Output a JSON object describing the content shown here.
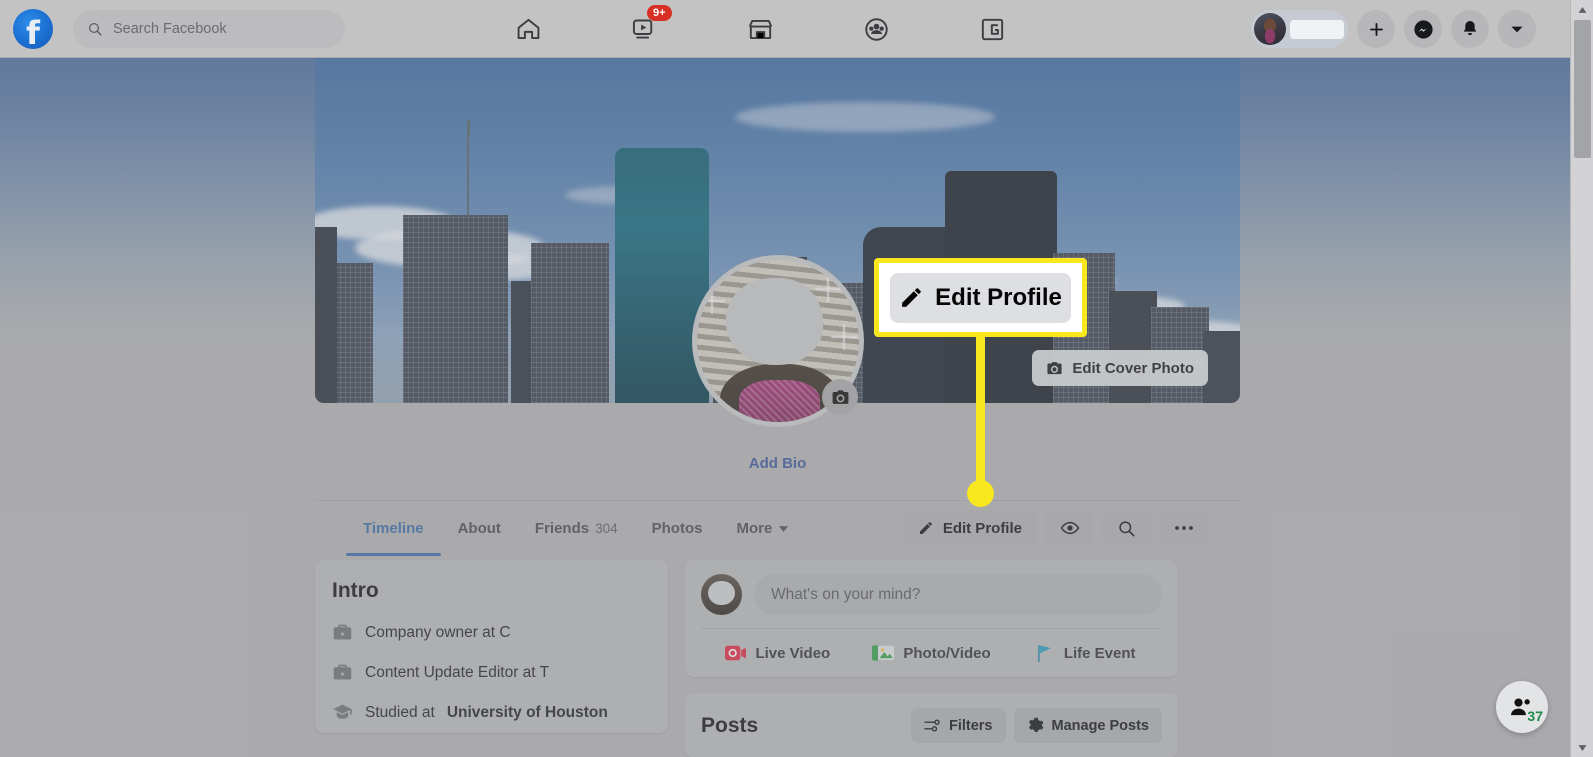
{
  "header": {
    "logo_icon": "facebook-logo",
    "search": {
      "placeholder": "Search Facebook",
      "icon": "search-icon"
    },
    "nav": [
      {
        "name": "home",
        "icon": "home-icon",
        "badge": ""
      },
      {
        "name": "watch",
        "icon": "video-icon",
        "badge": "9+"
      },
      {
        "name": "marketplace",
        "icon": "marketplace-icon",
        "badge": ""
      },
      {
        "name": "groups",
        "icon": "groups-icon",
        "badge": ""
      },
      {
        "name": "gaming",
        "icon": "gaming-icon",
        "badge": ""
      }
    ],
    "account": {
      "name_redacted": "",
      "icon": "avatar"
    },
    "right_buttons": [
      {
        "name": "create",
        "icon": "plus-icon"
      },
      {
        "name": "messenger",
        "icon": "messenger-icon"
      },
      {
        "name": "notifications",
        "icon": "bell-icon"
      },
      {
        "name": "account-menu",
        "icon": "chevron-down-icon"
      }
    ]
  },
  "cover": {
    "edit_cover_label": "Edit Cover Photo",
    "edit_cover_icon": "camera-icon",
    "profile_camera_icon": "camera-icon"
  },
  "callout": {
    "label": "Edit Profile",
    "icon": "pencil-icon",
    "border_color": "#f9e71e",
    "connector_color": "#f9e71e"
  },
  "bio": {
    "add_bio_label": "Add Bio",
    "link_color": "#3b5a9a"
  },
  "tabs": {
    "items": [
      {
        "label": "Timeline",
        "count": "",
        "active": true
      },
      {
        "label": "About",
        "count": "",
        "active": false
      },
      {
        "label": "Friends",
        "count": "304",
        "active": false
      },
      {
        "label": "Photos",
        "count": "",
        "active": false
      },
      {
        "label": "More",
        "count": "",
        "active": false
      }
    ],
    "more_icon": "chevron-down-icon",
    "actions": [
      {
        "label": "Edit Profile",
        "icon": "pencil-icon"
      },
      {
        "label": "",
        "icon": "eye-icon"
      },
      {
        "label": "",
        "icon": "search-icon"
      },
      {
        "label": "",
        "icon": "ellipsis-icon"
      }
    ]
  },
  "intro": {
    "title": "Intro",
    "rows": [
      {
        "icon": "briefcase-icon",
        "text": "Company owner at C",
        "bold": ""
      },
      {
        "icon": "briefcase-icon",
        "text": "Content Update Editor at T",
        "bold": ""
      },
      {
        "icon": "graduation-cap-icon",
        "text": "Studied at ",
        "bold": "University of Houston"
      }
    ]
  },
  "composer": {
    "placeholder": "What's on your mind?",
    "actions": [
      {
        "label": "Live Video",
        "icon": "live-video-icon",
        "color": "#e02c45"
      },
      {
        "label": "Photo/Video",
        "icon": "photo-video-icon",
        "color": "#37a04b"
      },
      {
        "label": "Life Event",
        "icon": "flag-icon",
        "color": "#2c9ec4"
      }
    ]
  },
  "posts": {
    "title": "Posts",
    "buttons": [
      {
        "label": "Filters",
        "icon": "sliders-icon"
      },
      {
        "label": "Manage Posts",
        "icon": "gear-icon"
      }
    ]
  },
  "contacts_fab": {
    "icon": "contacts-icon",
    "badge": "37",
    "badge_color": "#1f8a4c"
  }
}
